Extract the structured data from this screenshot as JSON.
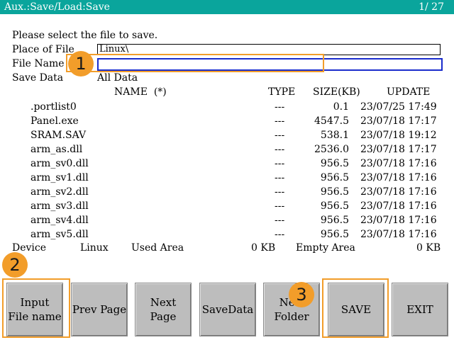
{
  "title": "Aux.:Save/Load:Save",
  "page_indicator": "1/ 27",
  "prompt": "Please select the file to save.",
  "place_label": "Place of File",
  "place_value": "Linux\\",
  "filename_label": "File Name",
  "filename_value": "",
  "savedata_label": "Save Data",
  "savedata_value": "All Data",
  "columns": {
    "name": "NAME  (*)",
    "type": "TYPE",
    "size": "SIZE(KB)",
    "update": "UPDATE"
  },
  "files": [
    {
      "name": ".portlist0",
      "type": "---",
      "size": "0.1",
      "update": "23/07/25 17:49"
    },
    {
      "name": "Panel.exe",
      "type": "---",
      "size": "4547.5",
      "update": "23/07/18 17:17"
    },
    {
      "name": "SRAM.SAV",
      "type": "---",
      "size": "538.1",
      "update": "23/07/18 19:12"
    },
    {
      "name": "arm_as.dll",
      "type": "---",
      "size": "2536.0",
      "update": "23/07/18 17:17"
    },
    {
      "name": "arm_sv0.dll",
      "type": "---",
      "size": "956.5",
      "update": "23/07/18 17:16"
    },
    {
      "name": "arm_sv1.dll",
      "type": "---",
      "size": "956.5",
      "update": "23/07/18 17:16"
    },
    {
      "name": "arm_sv2.dll",
      "type": "---",
      "size": "956.5",
      "update": "23/07/18 17:16"
    },
    {
      "name": "arm_sv3.dll",
      "type": "---",
      "size": "956.5",
      "update": "23/07/18 17:16"
    },
    {
      "name": "arm_sv4.dll",
      "type": "---",
      "size": "956.5",
      "update": "23/07/18 17:16"
    },
    {
      "name": "arm_sv5.dll",
      "type": "---",
      "size": "956.5",
      "update": "23/07/18 17:16"
    }
  ],
  "footer": {
    "device_label": "Device",
    "device_value": "Linux",
    "used_label": "Used Area",
    "used_value": "0 KB",
    "empty_label": "Empty Area",
    "empty_value": "0 KB"
  },
  "buttons": {
    "input_filename": "Input\nFile name",
    "prev_page": "Prev Page",
    "next_page": "Next Page",
    "save_data": "SaveData",
    "new_folder": "New\nFolder",
    "save": "SAVE",
    "exit": "EXIT"
  },
  "callouts": {
    "one": "1",
    "two": "2",
    "three": "3"
  },
  "colors": {
    "titlebar": "#0aa59c",
    "highlight": "#f29d2a",
    "active_field_border": "#1a2ccc"
  }
}
